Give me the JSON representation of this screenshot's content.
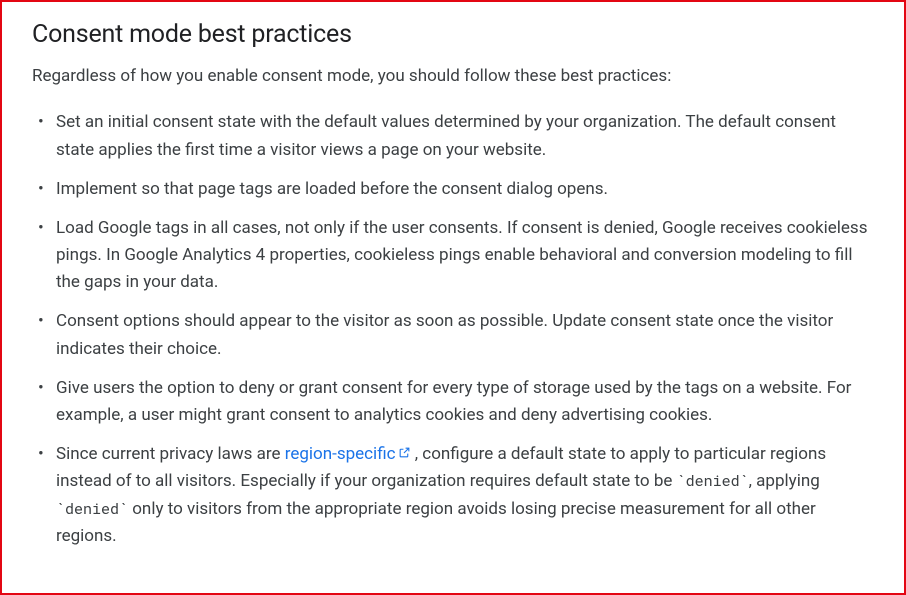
{
  "heading": "Consent mode best practices",
  "intro": "Regardless of how you enable consent mode, you should follow these best practices:",
  "items": [
    "Set an initial consent state with the default values determined by your organization. The default consent state applies the first time a visitor views a page on your website.",
    "Implement so that page tags are loaded before the consent dialog opens.",
    "Load Google tags in all cases, not only if the user consents. If consent is denied, Google receives cookieless pings. In Google Analytics 4 properties, cookieless pings enable behavioral and conversion modeling to fill the gaps in your data.",
    "Consent options should appear to the visitor as soon as possible. Update consent state once the visitor indicates their choice.",
    "Give users the option to deny or grant consent for every type of storage used by the tags on a website. For example, a user might grant consent to analytics cookies and deny advertising cookies."
  ],
  "item6": {
    "pre": "Since current privacy laws are ",
    "link": "region-specific",
    "post1": " , configure a default state to apply to particular regions instead of to all visitors. Especially if your organization requires default state to be ",
    "code1": "`denied`",
    "post2": ", applying ",
    "code2": "`denied`",
    "post3": " only to visitors from the appropriate region avoids losing precise measurement for all other regions."
  }
}
